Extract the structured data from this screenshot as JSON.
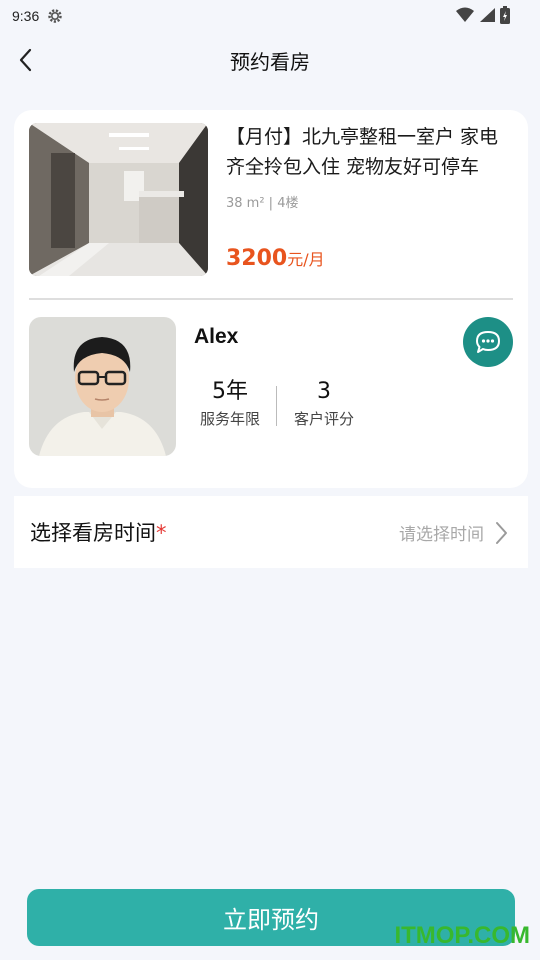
{
  "status_bar": {
    "time": "9:36",
    "icons": [
      "gear-icon",
      "wifi-icon",
      "signal-icon",
      "battery-icon"
    ]
  },
  "nav": {
    "title": "预约看房",
    "back_icon": "chevron-left-icon"
  },
  "listing": {
    "title": "【月付】北九亭整租一室户 家电齐全拎包入住 宠物友好可停车",
    "meta": "38 m² | 4楼",
    "price": "3200",
    "price_unit": "元/月"
  },
  "agent": {
    "name": "Alex",
    "chat_icon": "chat-bubble-icon",
    "years_value": "5年",
    "years_label": "服务年限",
    "rating_value": "3",
    "rating_label": "客户评分"
  },
  "time_select": {
    "label": "选择看房时间",
    "required_mark": "*",
    "placeholder": "请选择时间"
  },
  "submit": {
    "label": "立即预约"
  },
  "watermark": "ITMOP.COM",
  "colors": {
    "accent": "#2fb0a8",
    "chat_button": "#1d8f86",
    "price": "#e8541e",
    "required": "#e53935"
  }
}
